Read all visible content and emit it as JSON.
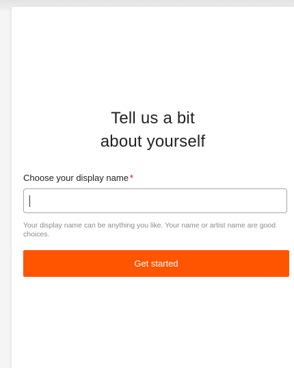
{
  "dialog": {
    "heading": "Tell us a bit about yourself",
    "display_name": {
      "label": "Choose your display name",
      "required_marker": "*",
      "value": "",
      "placeholder": "",
      "hint": "Your display name can be anything you like. Your name or artist name are good choices."
    },
    "submit_label": "Get started"
  },
  "colors": {
    "accent": "#ff5500",
    "required": "#d0021b",
    "hint": "#8a8a8a"
  }
}
